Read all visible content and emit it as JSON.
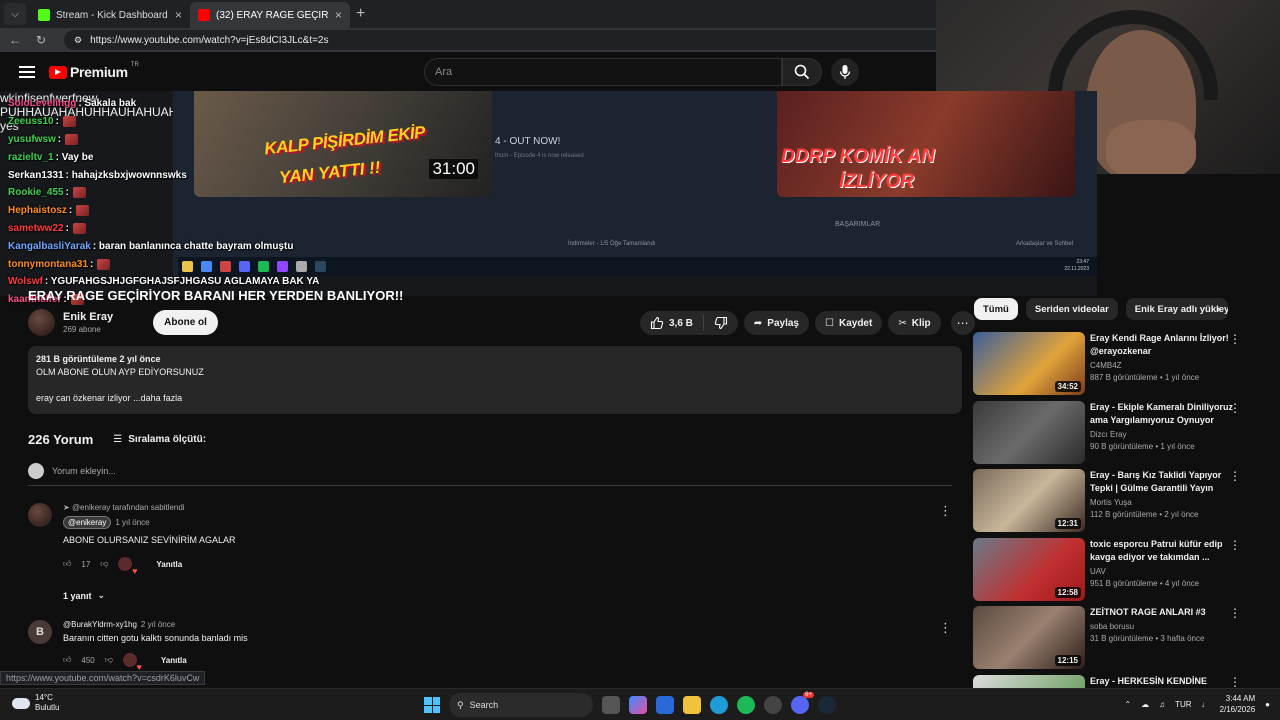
{
  "browser": {
    "tabs": [
      {
        "title": "Stream - Kick Dashboard",
        "icon": "kick-icon",
        "color": "#53fc18"
      },
      {
        "title": "(32) ERAY RAGE GEÇİRİYOR BARAN",
        "icon": "youtube-icon",
        "color": "#ff0000"
      }
    ],
    "url": "https://www.youtube.com/watch?v=jEs8dCI3JLc&t=2s"
  },
  "youtube": {
    "logo": "Premium",
    "country": "TR",
    "search_placeholder": "Ara"
  },
  "stream_overlay": {
    "chat": [
      {
        "user": "SoloLevelingg",
        "color": "#ff4b8b",
        "msg": ": Sakala bak",
        "emote": false
      },
      {
        "user": "Zeeuss10",
        "color": "#3fd34f",
        "msg": " :",
        "emote": true
      },
      {
        "user": "yusufwsw",
        "color": "#3fd34f",
        "msg": " :",
        "emote": true
      },
      {
        "user": "razieltv_1",
        "color": "#3fd34f",
        "msg": " : Vay be",
        "emote": false
      },
      {
        "user": "Serkan1331",
        "color": "#ffffff",
        "msg": " : hahajzksbxjwownnswks",
        "emote": false
      },
      {
        "user": "Rookie_455",
        "color": "#3fd34f",
        "msg": " :",
        "emote": true
      },
      {
        "user": "Hephaistosz",
        "color": "#ff8c1a",
        "msg": " :",
        "emote": true
      },
      {
        "user": "sametww22",
        "color": "#ff3b3b",
        "msg": " :",
        "emote": true
      },
      {
        "user": "KangalbasliYarak",
        "color": "#6fa8ff",
        "msg": " : baran banlanınca chatte bayram olmuştu",
        "emote": false
      },
      {
        "user": "tonnymontana31",
        "color": "#ff8c1a",
        "msg": " :",
        "emote": true
      },
      {
        "user": "Wolswf",
        "color": "#ff3b3b",
        "msg": " : YGUFAHGSJHJGFGHAJSFJHGASU AGLAMAYA BAK YA",
        "emote": false
      },
      {
        "user": "kaanthelfer",
        "color": "#ff4b8b",
        "msg": " :",
        "emote": true
      }
    ],
    "inner_lines": [
      "wkjnfisenfwerfnew",
      "PUHHAUAHAHUHHAUHAHUAHUAHUAHUA",
      "yes"
    ],
    "thumb_left_line1": "KALP PİŞİRDİM EKİP",
    "thumb_left_line2": "YAN YATTI !!",
    "thumb_left_duration": "31:00",
    "thumb_right_line1": "DDRP KOMİK AN",
    "thumb_right_line2": "İZLİYOR",
    "steam_news_title": "4 - OUT NOW!",
    "steam_news_sub": "thom - Episode 4 is now released",
    "steam_achievements": "BAŞARIMLAR",
    "steam_downloads": "İndirmeler - 1/5 Öğe Tamamlandı",
    "steam_friends": "Arkadaşlar ve Sohbet",
    "inner_time": "23:47",
    "inner_date": "22.11.2023"
  },
  "video": {
    "title": "ERAY RAGE GEÇİRİYOR BARANI HER YERDEN BANLIYOR!!",
    "channel": "Enik Eray",
    "subscribers": "269 abone",
    "subscribe_label": "Abone ol",
    "likes": "3,6 B",
    "share_label": "Paylaş",
    "save_label": "Kaydet",
    "clip_label": "Klip",
    "description": {
      "meta": "281 B görüntüleme  2 yıl önce",
      "line1": "OLM ABONE OLUN AYP EDİYORSUNUZ",
      "line2": "eray can özkenar izliyor",
      "more": "...daha fazla"
    }
  },
  "comments": {
    "count_label": "226 Yorum",
    "sort_label": "Sıralama ölçütü:",
    "add_placeholder": "Yorum ekleyin...",
    "items": [
      {
        "pinned": "@enikeray tarafından sabitlendi",
        "author": "@enikeray",
        "time": "1 yıl önce",
        "text": "ABONE OLURSANIZ SEVİNİRİM AGALAR",
        "likes": "17",
        "reply_label": "Yanıtla"
      },
      {
        "author": "@BurakYldrm-xy1hg",
        "avatar_letter": "B",
        "time": "2 yıl önce",
        "text": "Baranın citten gotu kalktı sonunda banladı mis",
        "likes": "450",
        "reply_label": "Yanıtla"
      }
    ],
    "replies_label": "1 yanıt"
  },
  "status_url": "https://www.youtube.com/watch?v=csdrK6luvCw",
  "sidebar": {
    "chips": [
      "Tümü",
      "Seriden videolar",
      "Enik Eray adlı yükleyi"
    ],
    "recs": [
      {
        "title": "Eray Kendi Rage Anlarını İzliyor! @erayozkenar",
        "channel": "C4MB4Z",
        "views": "887 B görüntüleme • 1 yıl önce",
        "duration": "34:52",
        "bg": "linear-gradient(135deg,#3d5f9a,#e0a33a 60%,#7a3b1b)"
      },
      {
        "title": "Eray - Ekiple Kameralı Diniliyoruz ama Yargılamıyoruz Oynuyor",
        "channel": "Dizcı Eray",
        "views": "90 B görüntüleme • 1 yıl önce",
        "duration": "",
        "bg": "linear-gradient(135deg,#3a3a3a,#6b6b6b 50%,#2a2a2a)"
      },
      {
        "title": "Eray - Barış Kız Taklidi Yapıyor Tepki | Gülme Garantili Yayın",
        "channel": "Mortis Yuşa",
        "views": "112 B görüntüleme • 2 yıl önce",
        "duration": "12:31",
        "bg": "linear-gradient(135deg,#7a6a5a,#c9b79a 50%,#3a2a22)"
      },
      {
        "title": "toxic esporcu Patrui küfür edip kavga ediyor ve takımdan ...",
        "channel": "UAV",
        "views": "951 B görüntüleme • 4 yıl önce",
        "duration": "12:58",
        "bg": "linear-gradient(135deg,#6a7a88,#c03030 60%,#a01818)"
      },
      {
        "title": "ZEİTNOT RAGE ANLARI #3",
        "channel": "soba borusu",
        "views": "31 B görüntüleme • 3 hafta önce",
        "duration": "12:15",
        "bg": "linear-gradient(135deg,#5a4a40,#9a8070 50%,#2a1d18)"
      },
      {
        "title": "Eray - HERKESİN KENDİNE",
        "channel": "",
        "views": "",
        "duration": "",
        "bg": "linear-gradient(135deg,#ddd,#4a8a3a)"
      }
    ]
  },
  "taskbar": {
    "temp": "14°C",
    "weather": "Bulutlu",
    "search_label": "Search",
    "lang": "TUR",
    "time": "3:44 AM",
    "date": "2/16/2026",
    "discord_badge": "6+"
  }
}
